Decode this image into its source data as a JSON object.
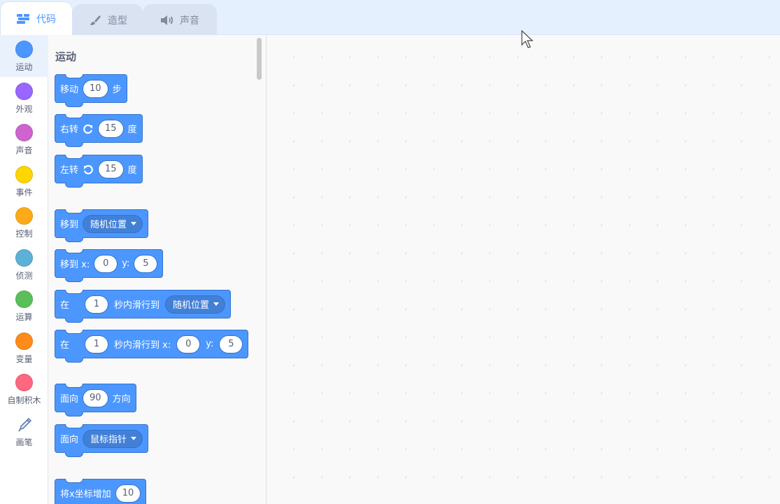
{
  "tabs": [
    {
      "label": "代码",
      "icon": "code-icon",
      "active": true
    },
    {
      "label": "造型",
      "icon": "brush-icon",
      "active": false
    },
    {
      "label": "声音",
      "icon": "speaker-icon",
      "active": false
    }
  ],
  "categories": [
    {
      "label": "运动",
      "color": "#4c97ff",
      "selected": true
    },
    {
      "label": "外观",
      "color": "#9966ff"
    },
    {
      "label": "声音",
      "color": "#cf63cf"
    },
    {
      "label": "事件",
      "color": "#ffd500"
    },
    {
      "label": "控制",
      "color": "#ffab19"
    },
    {
      "label": "侦测",
      "color": "#5cb1d6"
    },
    {
      "label": "运算",
      "color": "#59c059"
    },
    {
      "label": "变量",
      "color": "#ff8c1a"
    },
    {
      "label": "自制积木",
      "color": "#ff6680"
    },
    {
      "label": "画笔",
      "icon": "pen-icon"
    }
  ],
  "flyout": {
    "title": "运动",
    "blocks": {
      "move": {
        "label": "移动",
        "value": "10",
        "suffix": "步"
      },
      "turn_right": {
        "label": "右转",
        "value": "15",
        "suffix": "度"
      },
      "turn_left": {
        "label": "左转",
        "value": "15",
        "suffix": "度"
      },
      "goto": {
        "label": "移到",
        "dropdown": "随机位置"
      },
      "goto_xy": {
        "label": "移到 x:",
        "x": "0",
        "y_label": "y:",
        "y": "5"
      },
      "glide_to": {
        "label": "在",
        "value": "1",
        "mid": "秒内滑行到",
        "dropdown": "随机位置"
      },
      "glide_xy": {
        "label": "在",
        "value": "1",
        "mid": "秒内滑行到 x:",
        "x": "0",
        "y_label": "y:",
        "y": "5"
      },
      "point_dir": {
        "label": "面向",
        "value": "90",
        "suffix": "方向"
      },
      "point_towards": {
        "label": "面向",
        "dropdown": "鼠标指针"
      },
      "change_x": {
        "label": "将x坐标增加",
        "value": "10"
      }
    }
  },
  "colors": {
    "motion": "#4c97ff",
    "motion_dark": "#3373cc",
    "tab_bar": "#e5f0ff"
  }
}
